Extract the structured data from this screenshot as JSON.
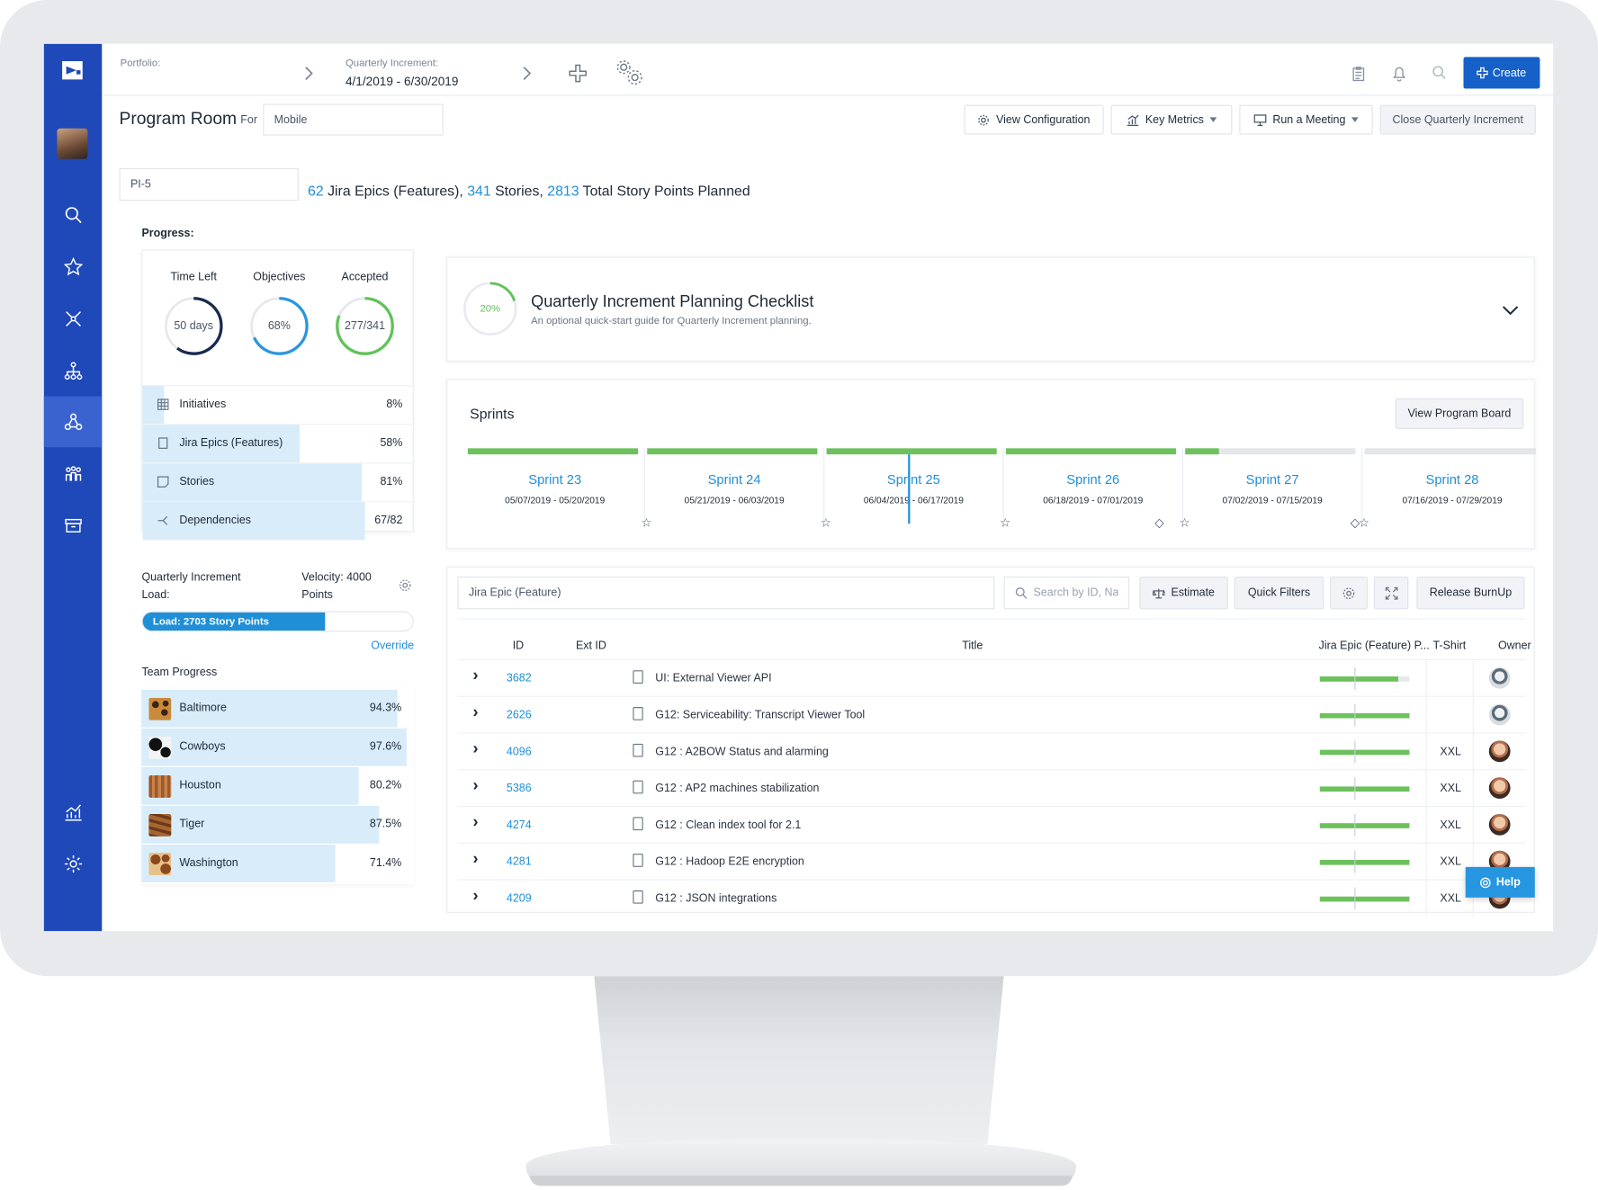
{
  "header": {
    "portfolio_label": "Portfolio:",
    "qi_label": "Quarterly Increment:",
    "qi_value": "4/1/2019 - 6/30/2019",
    "create_label": "Create"
  },
  "program": {
    "title": "Program Room",
    "for_label": "For",
    "team_value": "Mobile",
    "buttons": {
      "view_config": "View Configuration",
      "key_metrics": "Key Metrics",
      "run_meeting": "Run a Meeting",
      "close_qi": "Close Quarterly Increment"
    },
    "pi_value": "PI-5"
  },
  "summary": {
    "epics_n": "62",
    "epics_t": " Jira Epics (Features), ",
    "stories_n": "341",
    "stories_t": " Stories, ",
    "points_n": "2813",
    "points_t": " Total Story Points Planned"
  },
  "progress": {
    "heading": "Progress:",
    "gauges": [
      {
        "label": "Time Left",
        "value": "50 days",
        "fraction": 0.6,
        "color": "#1a2a4f"
      },
      {
        "label": "Objectives",
        "value": "68%",
        "fraction": 0.68,
        "color": "#2a97dd"
      },
      {
        "label": "Accepted",
        "value": "277/341",
        "fraction": 0.81,
        "color": "#61c25a"
      }
    ],
    "rows": [
      {
        "name": "Initiatives",
        "pct": "8%",
        "fill": 0.08,
        "icon": "grid-icon"
      },
      {
        "name": "Jira Epics (Features)",
        "pct": "58%",
        "fill": 0.58,
        "icon": "document-icon"
      },
      {
        "name": "Stories",
        "pct": "81%",
        "fill": 0.81,
        "icon": "note-icon"
      },
      {
        "name": "Dependencies",
        "pct": "67/82",
        "fill": 0.82,
        "icon": "dependency-icon"
      }
    ]
  },
  "load": {
    "qi_load_1": "Quarterly Increment",
    "qi_load_2": "Load:",
    "velocity_1": "Velocity: 4000",
    "velocity_2": "Points",
    "bar_text": "Load: 2703 Story Points",
    "fill": 0.676,
    "override": "Override"
  },
  "teams": {
    "heading": "Team Progress",
    "items": [
      {
        "name": "Baltimore",
        "pct": "94.3%",
        "fill": 0.943,
        "tex": "leopard"
      },
      {
        "name": "Cowboys",
        "pct": "97.6%",
        "fill": 0.976,
        "tex": "cow"
      },
      {
        "name": "Houston",
        "pct": "80.2%",
        "fill": 0.802,
        "tex": "wood"
      },
      {
        "name": "Tiger",
        "pct": "87.5%",
        "fill": 0.875,
        "tex": "tiger"
      },
      {
        "name": "Washington",
        "pct": "71.4%",
        "fill": 0.714,
        "tex": "giraffe"
      }
    ]
  },
  "checklist": {
    "pct": "20%",
    "fraction": 0.2,
    "title": "Quarterly Increment Planning Checklist",
    "subtitle": "An optional quick-start guide for Quarterly Increment planning."
  },
  "sprints": {
    "heading": "Sprints",
    "board_button": "View Program Board",
    "items": [
      {
        "name": "Sprint 23",
        "dates": "05/07/2019 - 05/20/2019",
        "progress": 1.0
      },
      {
        "name": "Sprint 24",
        "dates": "05/21/2019 - 06/03/2019",
        "progress": 1.0
      },
      {
        "name": "Sprint 25",
        "dates": "06/04/2019 - 06/17/2019",
        "progress": 1.0
      },
      {
        "name": "Sprint 26",
        "dates": "06/18/2019 - 07/01/2019",
        "progress": 1.0
      },
      {
        "name": "Sprint 27",
        "dates": "07/02/2019 - 07/15/2019",
        "progress": 0.2
      },
      {
        "name": "Sprint 28",
        "dates": "07/16/2019 - 07/29/2019",
        "progress": 0.0
      }
    ]
  },
  "table": {
    "filter_value": "Jira Epic (Feature)",
    "search_placeholder": "Search by ID, Na",
    "estimate": "Estimate",
    "quick_filters": "Quick Filters",
    "burnup": "Release BurnUp",
    "headers": {
      "id": "ID",
      "ext_id": "Ext ID",
      "title": "Title",
      "progress": "Jira Epic (Feature) P...",
      "tshirt": "T-Shirt",
      "owner": "Owner"
    },
    "rows": [
      {
        "id": "3682",
        "title": "UI: External Viewer API",
        "size": "",
        "progress": 0.88,
        "owner": "alt"
      },
      {
        "id": "2626",
        "title": "G12: Serviceability: Transcript Viewer Tool",
        "size": "",
        "progress": 1.0,
        "owner": "alt"
      },
      {
        "id": "4096",
        "title": "G12 : A2BOW Status and alarming",
        "size": "XXL",
        "progress": 1.0,
        "owner": "std"
      },
      {
        "id": "5386",
        "title": "G12 : AP2 machines stabilization",
        "size": "XXL",
        "progress": 1.0,
        "owner": "std"
      },
      {
        "id": "4274",
        "title": "G12 : Clean index tool for 2.1",
        "size": "XXL",
        "progress": 1.0,
        "owner": "std"
      },
      {
        "id": "4281",
        "title": "G12 : Hadoop E2E encryption",
        "size": "XXL",
        "progress": 1.0,
        "owner": "std"
      },
      {
        "id": "4209",
        "title": "G12 : JSON integrations",
        "size": "XXL",
        "progress": 1.0,
        "owner": "std"
      }
    ]
  },
  "help_label": "Help",
  "colors": {
    "sidebar": "#1f48b8",
    "accent": "#1f8fd8",
    "green": "#6cc15c"
  }
}
